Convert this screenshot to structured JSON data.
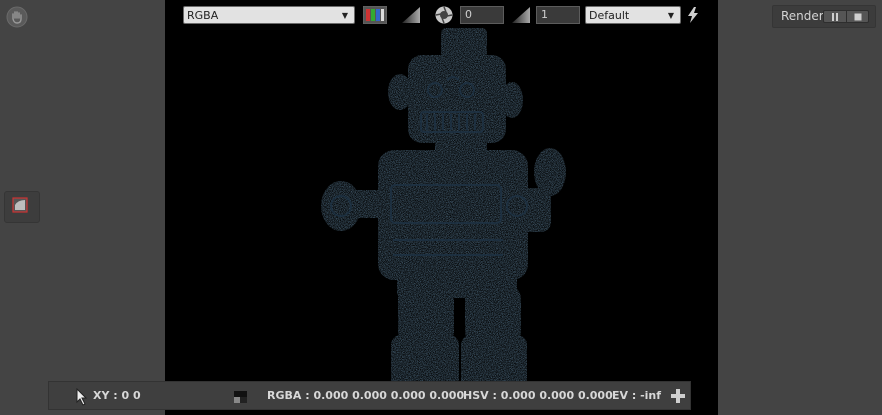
{
  "toolbar": {
    "channel_select": "RGBA",
    "exposure_value": "0",
    "gamma_value": "1",
    "display_select": "Default",
    "icons": [
      "color-channels-icon",
      "gradient-ramp-icon",
      "aperture-icon",
      "gradient-ramp-icon",
      "lightning-icon"
    ]
  },
  "render": {
    "label": "Render",
    "controls": [
      "pause-icon",
      "stop-icon"
    ]
  },
  "status": {
    "xy": "XY : 0 0",
    "rgba": "RGBA : 0.000 0.000 0.000 0.000",
    "hsv": "HSV : 0.000 0.000 0.000",
    "ev": "EV : -inf"
  },
  "colors": {
    "background": "#444444",
    "viewport": "#000000",
    "robot": "#6f98b6",
    "accent_red": "#cc3333"
  }
}
